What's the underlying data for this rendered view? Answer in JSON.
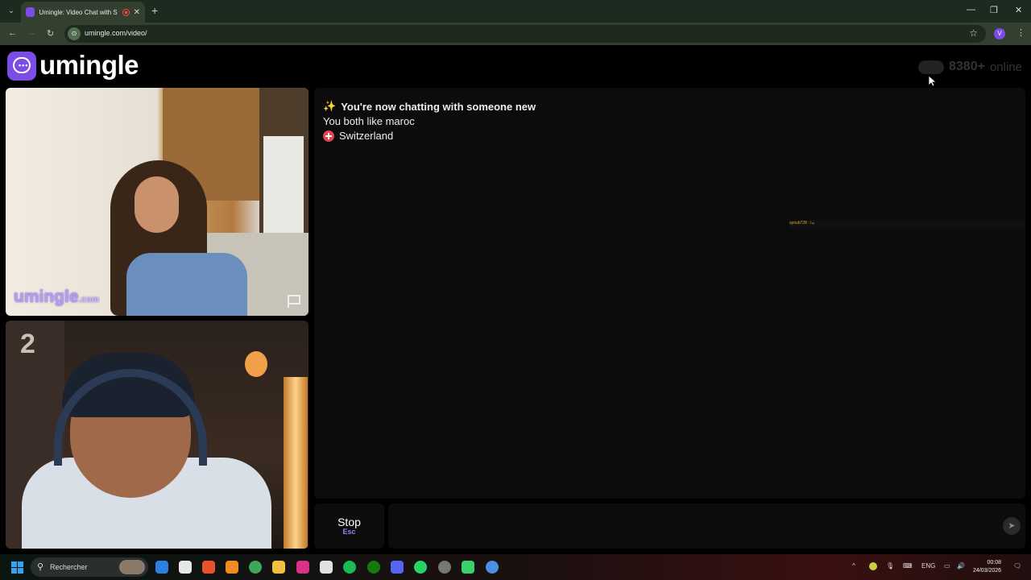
{
  "browser": {
    "tab_title": "Umingle: Video Chat with S",
    "url": "umingle.com/video/",
    "profile_initial": "V"
  },
  "header": {
    "logo_text": "umingle",
    "online_count": "8380+",
    "online_label": "online"
  },
  "video": {
    "watermark": "umingle",
    "watermark_suffix": ".com"
  },
  "chat": {
    "status": "You're now chatting with someone new",
    "common_interest": "You both like maroc",
    "country": "Switzerland",
    "overlay_tag": "ayoub728 : بدا"
  },
  "controls": {
    "stop_label": "Stop",
    "stop_key": "Esc",
    "message_placeholder": ""
  },
  "taskbar": {
    "search_label": "Rechercher",
    "language": "ENG",
    "time": "00:08",
    "date": "24/03/2026"
  },
  "colors": {
    "brand": "#7b4ce6",
    "panel": "#0c0c0c"
  }
}
